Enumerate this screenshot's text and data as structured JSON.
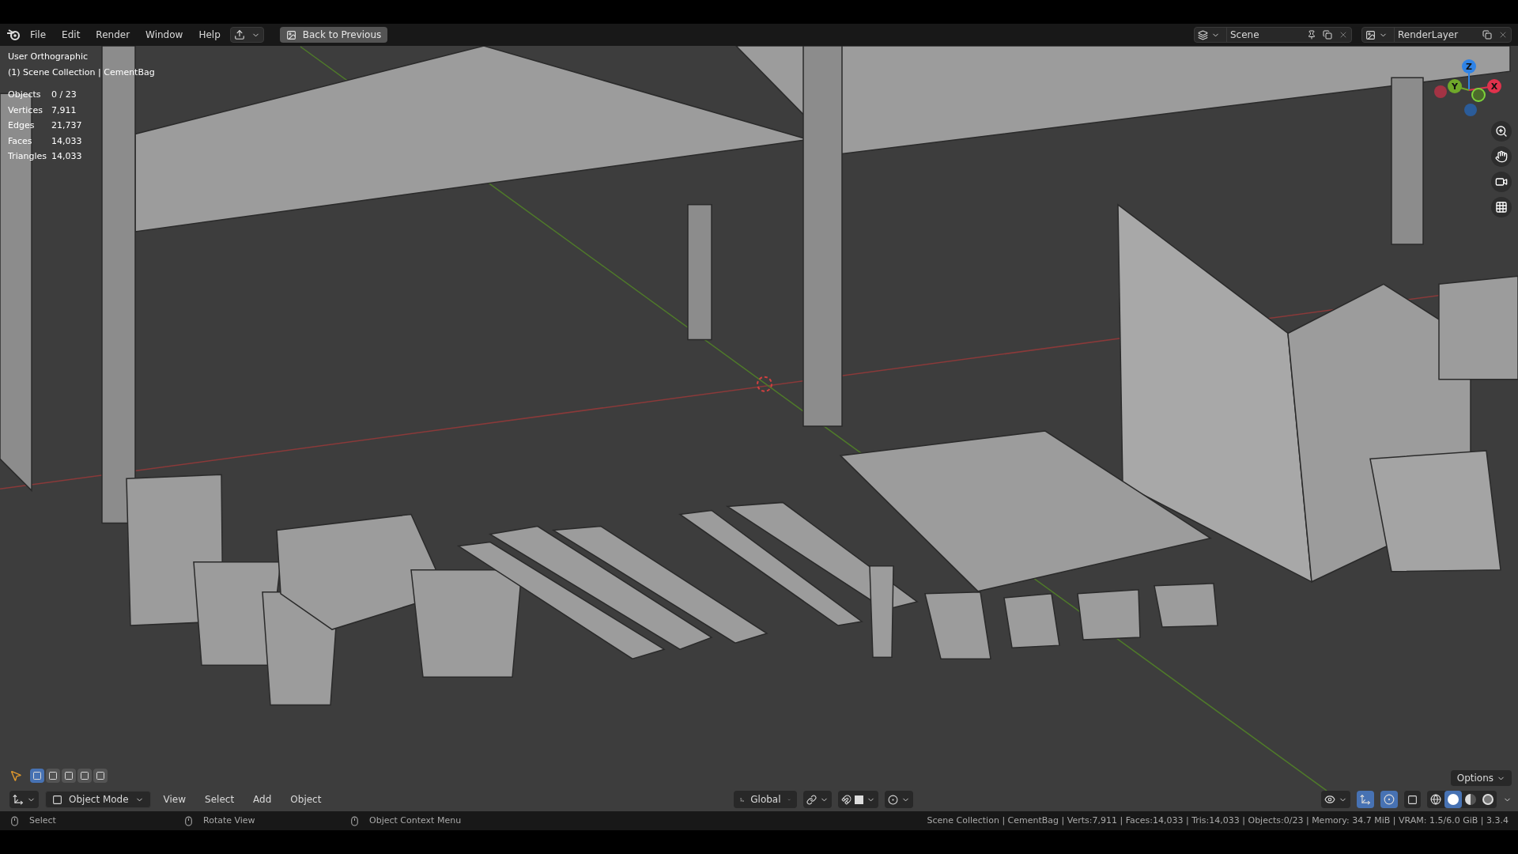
{
  "menu": [
    "File",
    "Edit",
    "Render",
    "Window",
    "Help"
  ],
  "back_button": {
    "label": "Back to Previous"
  },
  "scene": {
    "value": "Scene"
  },
  "view_layer": {
    "value": "RenderLayer"
  },
  "viewport": {
    "view_name": "User Orthographic",
    "collection": "(1) Scene Collection | CementBag",
    "stats": [
      {
        "label": "Objects",
        "value": "0 / 23"
      },
      {
        "label": "Vertices",
        "value": "7,911"
      },
      {
        "label": "Edges",
        "value": "21,737"
      },
      {
        "label": "Faces",
        "value": "14,033"
      },
      {
        "label": "Triangles",
        "value": "14,033"
      }
    ]
  },
  "gizmo_axes": [
    {
      "label": "Z",
      "color": "#2f83e6"
    },
    {
      "label": "Y",
      "color": "#6fa82a"
    },
    {
      "label": "X",
      "color": "#e0324c"
    }
  ],
  "select_modes": [
    {
      "selected": true
    },
    {
      "selected": false
    },
    {
      "selected": false
    },
    {
      "selected": false
    },
    {
      "selected": false
    }
  ],
  "mode": "Object Mode",
  "header_menus": [
    "View",
    "Select",
    "Add",
    "Object"
  ],
  "orientation": "Global",
  "snapping": {
    "on": false
  },
  "proportional_edit": {
    "on": false
  },
  "options": "Options",
  "shading_modes": [
    {
      "kind": "wireframe",
      "selected": false
    },
    {
      "kind": "solid",
      "selected": true
    },
    {
      "kind": "material",
      "selected": false
    },
    {
      "kind": "rendered",
      "selected": false
    }
  ],
  "status_hints": [
    "Select",
    "Rotate View",
    "Object Context Menu"
  ],
  "status_info": "Scene Collection | CementBag | Verts:7,911 | Faces:14,033 | Tris:14,033 | Objects:0/23 | Memory: 34.7 MiB | VRAM: 1.5/6.0 GiB | 3.3.4"
}
